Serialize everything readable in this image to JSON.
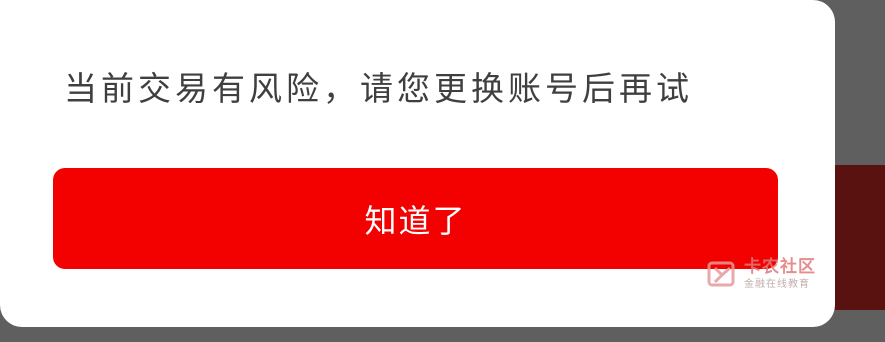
{
  "dialog": {
    "message": "当前交易有风险，请您更换账号后再试",
    "confirm_label": "知道了"
  },
  "watermark": {
    "title": "卡农社区",
    "subtitle": "金融在线教育",
    "icon": "kanong-logo-icon"
  },
  "colors": {
    "button_bg": "#f30000",
    "message_text": "#3f3f3f",
    "overlay": "#5f5f5f",
    "dialog_bg": "#ffffff"
  }
}
